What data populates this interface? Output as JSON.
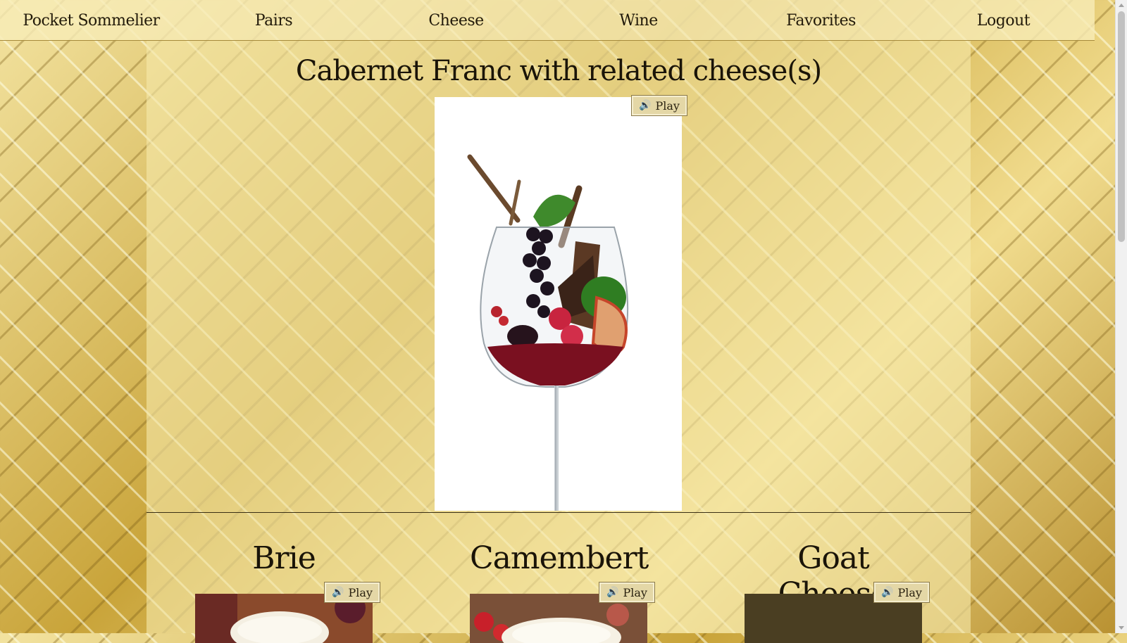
{
  "nav": {
    "brand": "Pocket Sommelier",
    "pairs": "Pairs",
    "cheese": "Cheese",
    "wine": "Wine",
    "favorites": "Favorites",
    "logout": "Logout"
  },
  "wine": {
    "title": "Cabernet Franc with related cheese(s)",
    "play_label": "Play",
    "image_icon": "wine-glass-with-fruits-icon"
  },
  "cheeses": [
    {
      "name": "Brie",
      "play_label": "Play",
      "image_icon": "brie-cheese-icon"
    },
    {
      "name": "Camembert",
      "play_label": "Play",
      "image_icon": "camembert-cheese-icon"
    },
    {
      "name": "Goat Cheese",
      "play_label": "Play",
      "image_icon": "goat-cheese-icon"
    }
  ],
  "icons": {
    "speaker": "speaker-icon"
  },
  "colors": {
    "nav_bg": "#f7ecb8",
    "button_bg": "#e4d7a6",
    "background_gold": "#d8b84a"
  }
}
